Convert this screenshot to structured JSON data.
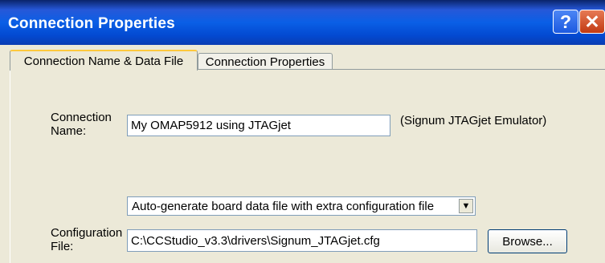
{
  "window": {
    "title": "Connection Properties"
  },
  "titlebar": {
    "help_glyph": "?",
    "close_glyph": "✕",
    "help_icon": "help-icon",
    "close_icon": "close-icon"
  },
  "tabs": [
    {
      "label": "Connection Name & Data File",
      "active": true
    },
    {
      "label": "Connection Properties",
      "active": false
    }
  ],
  "form": {
    "connection_name_label_line1": "Connection",
    "connection_name_label_line2": "Name:",
    "connection_name_value": "My OMAP5912 using JTAGjet",
    "emulator_note": "(Signum JTAGjet Emulator)",
    "board_file_option": "Auto-generate board data file with extra configuration file",
    "config_label_line1": "Configuration",
    "config_label_line2": "File:",
    "config_file_value": "C:\\CCStudio_v3.3\\drivers\\Signum_JTAGjet.cfg",
    "browse_label": "Browse..."
  },
  "colors": {
    "titlebar": "#0A5FE6",
    "close": "#C23A12",
    "face": "#ECE9D8",
    "tab_highlight": "#FFC83C"
  }
}
